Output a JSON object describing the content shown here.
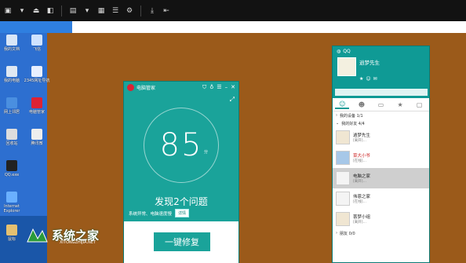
{
  "desktop_icons": [
    {
      "label": "我的文档",
      "color": "#d9e6f7"
    },
    {
      "label": "飞信",
      "color": "#cfe3ff"
    },
    {
      "label": "我的电脑",
      "color": "#dfe8f2"
    },
    {
      "label": "2345网址导航",
      "color": "#e8f0ff"
    },
    {
      "label": "网上邻居",
      "color": "#4a8fe0"
    },
    {
      "label": "电脑管家",
      "color": "#d23"
    },
    {
      "label": "回收站",
      "color": "#ddd"
    },
    {
      "label": "腾讯微",
      "color": "#eee"
    },
    {
      "label": "QQ.exe",
      "color": "#222"
    },
    {
      "label": "Internet Explorer",
      "color": "#6ab0ff"
    },
    {
      "label": "鼠标",
      "color": "#e5c070"
    }
  ],
  "pc_manager": {
    "title": "电脑管家",
    "score": "85",
    "unit": "分",
    "issues": "发现2个问题",
    "sub": "系统异常、电脑速度慢",
    "detail": "详情",
    "fix_button": "一键修复"
  },
  "qq": {
    "title": "QQ",
    "nickname": "逍梦先生",
    "groups": [
      {
        "label": "我的设备 1/1"
      },
      {
        "label": "我的好友 4/4"
      },
      {
        "label": "朋友 0/0"
      }
    ],
    "contacts": [
      {
        "name": "逍梦先生",
        "status": "[离开]…"
      },
      {
        "name": "菜大小爷",
        "status": "[在线]…"
      },
      {
        "name": "电脑之家",
        "status": "[离开]…"
      },
      {
        "name": "伟恩之家",
        "status": "[在线]…"
      },
      {
        "name": "菩梦小组",
        "status": "[离开]…"
      }
    ]
  },
  "watermark": {
    "main": "系统之家",
    "sub": "XITONGZHIJIA.NET"
  }
}
